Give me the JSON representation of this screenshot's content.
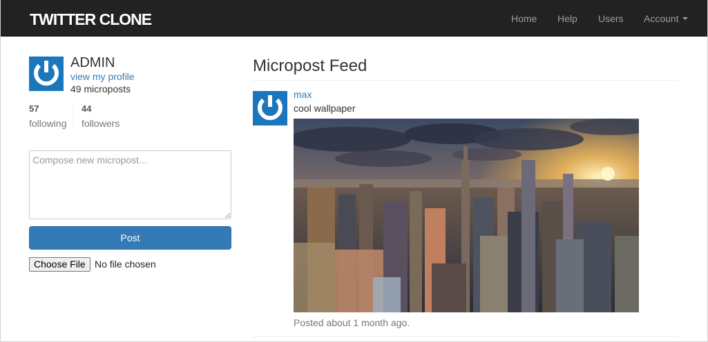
{
  "navbar": {
    "brand": "TWITTER CLONE",
    "items": [
      "Home",
      "Help",
      "Users"
    ],
    "account": "Account"
  },
  "sidebar": {
    "user_name": "ADMIN",
    "profile_link": "view my profile",
    "micropost_count": "49 microposts",
    "following_count": "57",
    "following_label": "following",
    "followers_count": "44",
    "followers_label": "followers",
    "compose_placeholder": "Compose new micropost...",
    "post_button": "Post",
    "choose_file_button": "Choose File",
    "file_status": "No file chosen"
  },
  "feed": {
    "title": "Micropost Feed",
    "posts": [
      {
        "user": "max",
        "content": "cool wallpaper",
        "image": "city-skyline-sunset-photo",
        "timestamp": "Posted about 1 month ago."
      }
    ]
  },
  "colors": {
    "navbar_bg": "#222222",
    "navbar_text": "#9d9d9d",
    "link": "#337ab7",
    "primary_button": "#337ab7",
    "gravatar": "#1a77bd"
  },
  "icons": {
    "avatar": "power-icon"
  }
}
